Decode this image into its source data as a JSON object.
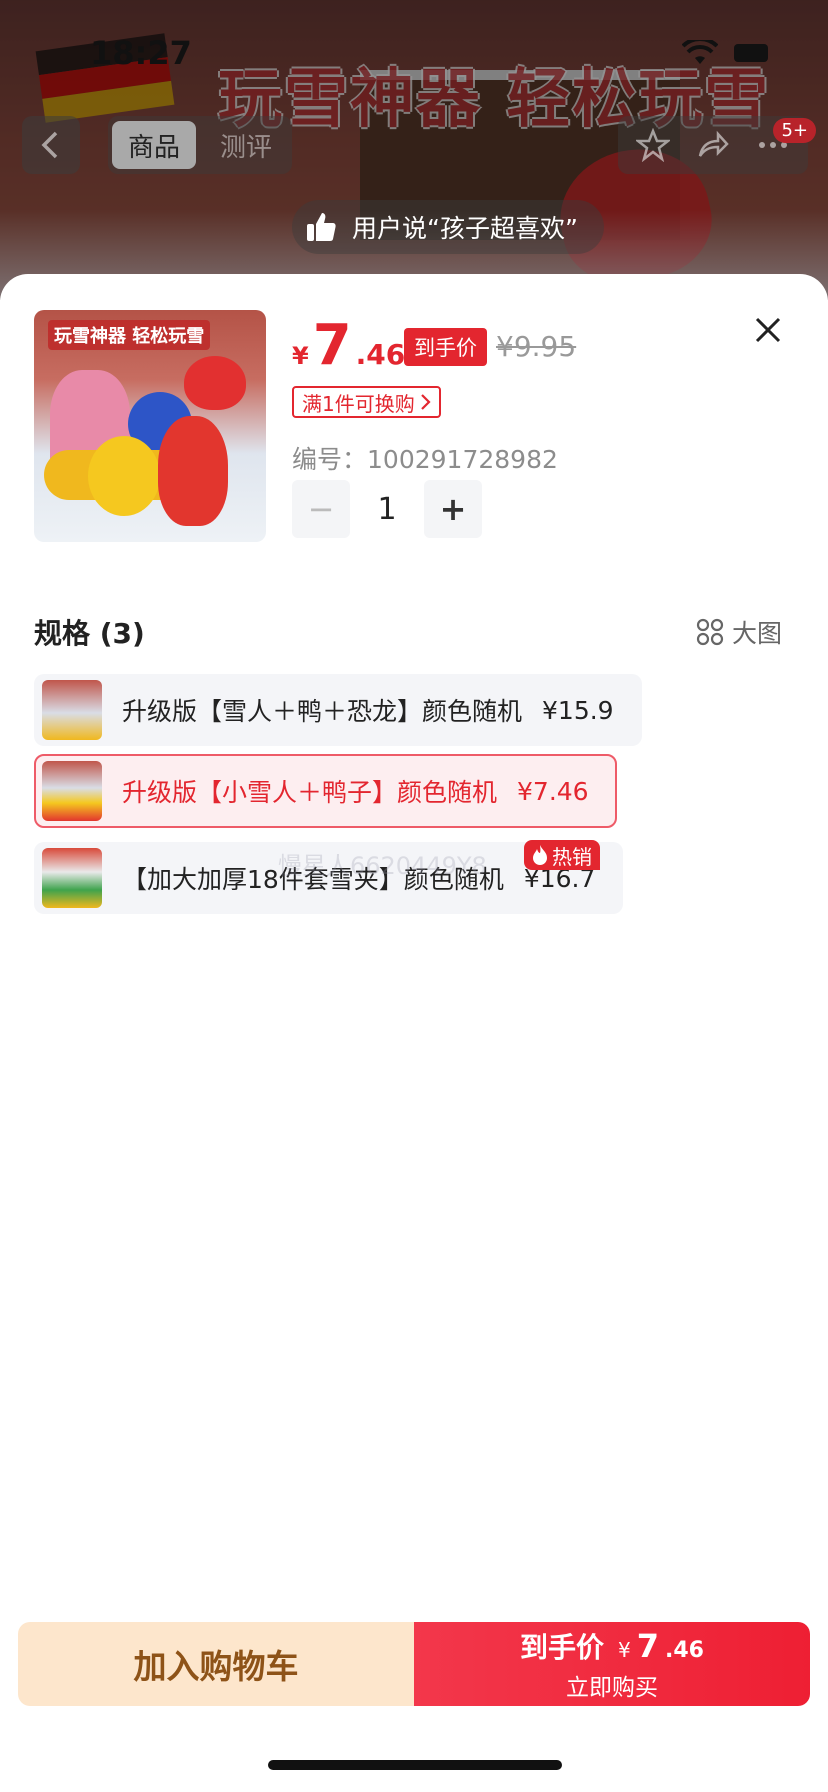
{
  "status_bar": {
    "time": "18:27"
  },
  "background": {
    "banner_title": "玩雪神器 轻松玩雪",
    "tabs": [
      {
        "label": "商品"
      },
      {
        "label": "测评"
      }
    ],
    "message_badge": "5+",
    "review_quote": "用户说“孩子超喜欢”"
  },
  "product": {
    "thumb_title": "玩雪神器 轻松玩雪",
    "price_symbol": "¥",
    "price_int": "7",
    "price_dec": ".46",
    "deal_tag": "到手价",
    "original_price": "¥9.95",
    "swap_tag": "满1件可换购",
    "sku_label": "编号：",
    "sku_number": "100291728982",
    "quantity": "1",
    "minus": "−",
    "plus": "+"
  },
  "specs": {
    "title": "规格 (3)",
    "big_view_label": "大图",
    "items": [
      {
        "label": "升级版【雪人＋鸭＋恐龙】颜色随机",
        "price": "¥15.9",
        "selected": false
      },
      {
        "label": "升级版【小雪人＋鸭子】颜色随机",
        "price": "¥7.46",
        "selected": true
      },
      {
        "label": "【加大加厚18件套雪夹】颜色随机",
        "price": "¥16.7",
        "selected": false
      }
    ],
    "hot_badge": "热销",
    "watermark": "慢星人6620449Y8"
  },
  "actions": {
    "cart_label": "加入购物车",
    "buy_label_top": "到手价",
    "buy_price_symbol": "¥",
    "buy_price_int": "7",
    "buy_price_dec": ".46",
    "buy_label_sub": "立即购买"
  },
  "colors": {
    "accent": "#e3262f",
    "cart_bg": "#fde6cc",
    "cart_text": "#8e5318"
  }
}
